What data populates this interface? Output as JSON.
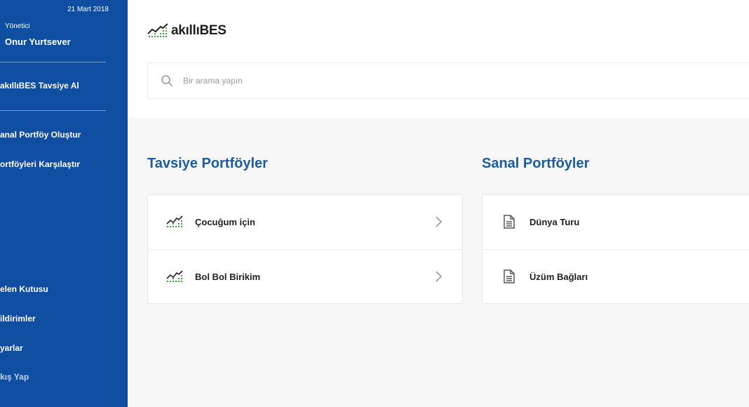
{
  "sidebar": {
    "date": "21 Mart 2018",
    "role": "Yönetici",
    "user_name": "Onur Yurtsever",
    "items": [
      {
        "label": "akıllıBES Tavsiye Al"
      },
      {
        "label": "anal Portföy Oluştur"
      },
      {
        "label": "ortföyleri Karşılaştır"
      },
      {
        "label": "elen Kutusu"
      },
      {
        "label": "ildirimler"
      },
      {
        "label": "yarlar"
      },
      {
        "label": "kış Yap"
      }
    ]
  },
  "header": {
    "logo_prefix": "akıllı",
    "logo_suffix": "BES",
    "logo_icon": "growth-chart-icon"
  },
  "search": {
    "placeholder": "Bir arama yapın",
    "icon": "search-icon"
  },
  "recommended": {
    "title": "Tavsiye Portföyler",
    "items": [
      {
        "label": "Çocuğum için",
        "icon": "growth-chart-icon"
      },
      {
        "label": "Bol Bol Birikim",
        "icon": "growth-chart-icon"
      }
    ]
  },
  "virtual": {
    "title": "Sanal Portföyler",
    "items": [
      {
        "label": "Dünya Turu",
        "icon": "document-icon"
      },
      {
        "label": "Üzüm Bağları",
        "icon": "document-icon"
      }
    ]
  },
  "colors": {
    "sidebar_bg": "#0f4ea1",
    "accent": "#1b5b9f",
    "logo_green": "#3c9e3c"
  }
}
